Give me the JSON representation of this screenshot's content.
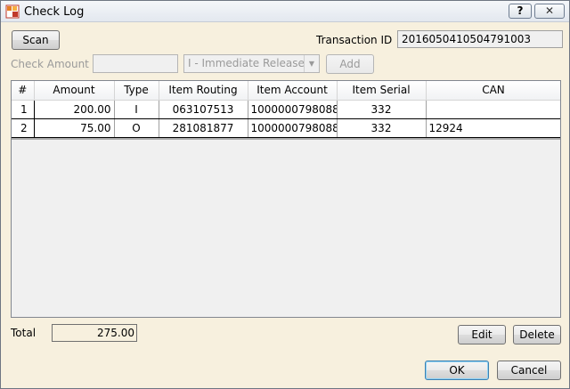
{
  "window": {
    "title": "Check Log",
    "help_label": "?",
    "close_label": "✕"
  },
  "toolbar": {
    "scan_label": "Scan",
    "transaction_label": "Transaction ID",
    "transaction_id": "2016050410504791003"
  },
  "entry": {
    "amount_label": "Check Amount",
    "amount_value": "",
    "release_option": "I - Immediate Release",
    "add_label": "Add"
  },
  "grid": {
    "headers": [
      "#",
      "Amount",
      "Type",
      "Item Routing",
      "Item Account",
      "Item Serial",
      "CAN"
    ],
    "rows": [
      [
        "1",
        "200.00",
        "I",
        "063107513",
        "1000000798088",
        "332",
        ""
      ],
      [
        "2",
        "75.00",
        "O",
        "281081877",
        "1000000798088",
        "332",
        "12924"
      ]
    ]
  },
  "footer": {
    "total_label": "Total",
    "total_value": "275.00",
    "edit_label": "Edit",
    "delete_label": "Delete",
    "ok_label": "OK",
    "cancel_label": "Cancel"
  }
}
